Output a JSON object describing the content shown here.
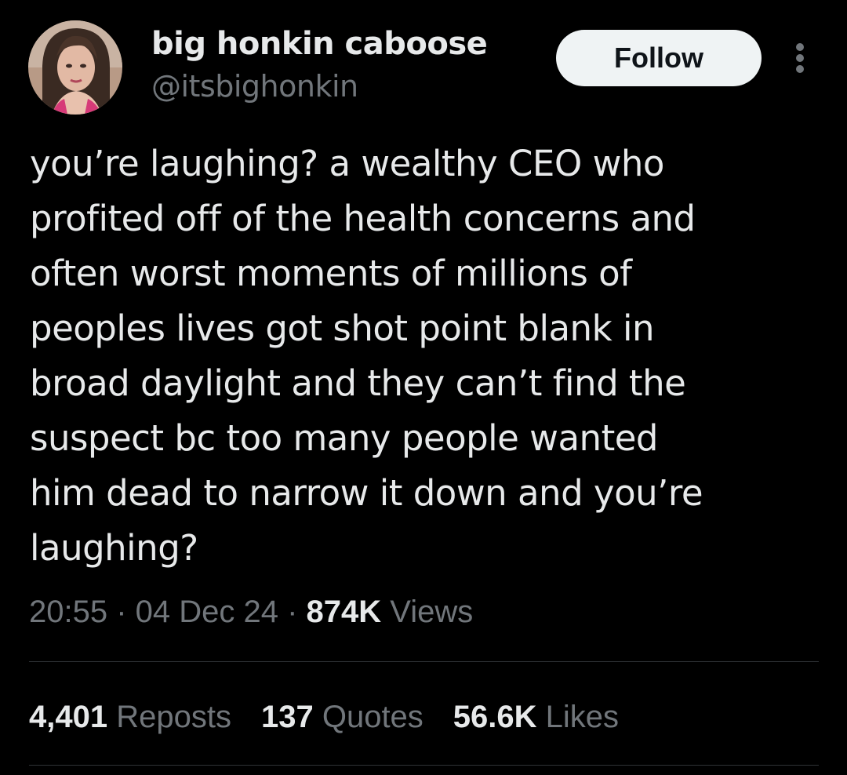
{
  "author": {
    "display_name": "big honkin caboose",
    "handle": "@itsbighonkin",
    "avatar_icon": "profile-photo"
  },
  "actions": {
    "follow_label": "Follow",
    "more_icon": "vertical-ellipsis-icon"
  },
  "tweet": {
    "text": "you’re laughing? a wealthy CEO who\nprofited off of the health concerns and\noften worst moments of millions of\npeoples lives got shot point blank in\nbroad daylight and they can’t find the\nsuspect bc too many people wanted\nhim dead to narrow it down and you’re\nlaughing?"
  },
  "meta": {
    "time": "20:55",
    "separator": " · ",
    "date": "04 Dec 24",
    "views_count": "874K",
    "views_label": " Views"
  },
  "stats": {
    "reposts_count": "4,401",
    "reposts_label": " Reposts",
    "quotes_count": "137",
    "quotes_label": " Quotes",
    "likes_count": "56.6K",
    "likes_label": " Likes"
  },
  "colors": {
    "background": "#000000",
    "primary_text": "#e7e9ea",
    "secondary_text": "#71767b",
    "follow_bg": "#eff3f4",
    "divider": "#2f3336"
  }
}
